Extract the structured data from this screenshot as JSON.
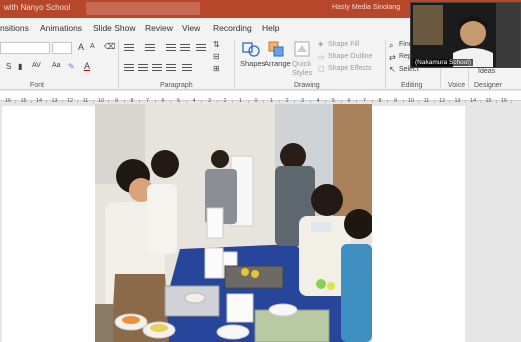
{
  "titlebar": {
    "doc_title": "with Nanyo School",
    "user_name": "Hasty Media Sinolang"
  },
  "tabs": [
    "nsitions",
    "Animations",
    "Slide Show",
    "Review",
    "View",
    "Recording",
    "Help"
  ],
  "ribbon": {
    "font_label": "Font",
    "paragraph_label": "Paragraph",
    "drawing_label": "Drawing",
    "editing_label": "Editing",
    "voice_label": "Voice",
    "designer_label": "Designer",
    "shapes_label": "Shapes",
    "arrange_label": "Arrange",
    "quick_styles_label_1": "Quick",
    "quick_styles_label_2": "Styles",
    "shape_fill": "Shape Fill",
    "shape_outline": "Shape Outline",
    "shape_effects": "Shape Effects",
    "find": "Find",
    "replace": "Replace",
    "select": "Select",
    "ideas": "Ideas",
    "font_size_a_up": "A",
    "font_size_a_down": "A",
    "bold_s": "S",
    "av_label": "AV",
    "aa_label": "Aa",
    "a_color": "A"
  },
  "ruler": {
    "ticks": [
      "16",
      "15",
      "14",
      "13",
      "12",
      "11",
      "10",
      "9",
      "8",
      "7",
      "6",
      "5",
      "4",
      "3",
      "2",
      "1",
      "0",
      "1",
      "2",
      "3",
      "4",
      "5",
      "6",
      "7",
      "8",
      "9",
      "10",
      "11",
      "12",
      "13",
      "14",
      "15",
      "16"
    ]
  },
  "webcam": {
    "name_label": "(Nakamura School)"
  },
  "colors": {
    "accent": "#b7472a",
    "ribbon_bg": "#f3f3f3",
    "canvas_bg": "#e6e6e6"
  }
}
